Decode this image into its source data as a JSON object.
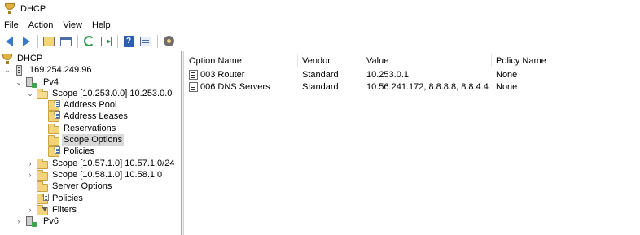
{
  "window": {
    "title": "DHCP"
  },
  "menu": [
    "File",
    "Action",
    "View",
    "Help"
  ],
  "toolbar": {
    "buttons": [
      "back-icon",
      "forward-icon",
      "up-folder-icon",
      "show-hide-tree-icon",
      "refresh-icon",
      "export-list-icon",
      "help-icon",
      "properties-icon",
      "dhcp-manage-icon"
    ]
  },
  "tree": {
    "root": "DHCP",
    "server": "169.254.249.96",
    "ipv4": "IPv4",
    "scope1": "Scope [10.253.0.0] 10.253.0.0",
    "address_pool": "Address Pool",
    "address_leases": "Address Leases",
    "reservations": "Reservations",
    "scope_options": "Scope Options",
    "policies_scope": "Policies",
    "scope2": "Scope [10.57.1.0] 10.57.1.0/24",
    "scope3": "Scope [10.58.1.0] 10.58.1.0",
    "server_options": "Server Options",
    "policies": "Policies",
    "filters": "Filters",
    "ipv6": "IPv6"
  },
  "list": {
    "columns": [
      "Option Name",
      "Vendor",
      "Value",
      "Policy Name"
    ],
    "rows": [
      {
        "option_name": "003 Router",
        "vendor": "Standard",
        "value": "10.253.0.1",
        "policy_name": "None"
      },
      {
        "option_name": "006 DNS Servers",
        "vendor": "Standard",
        "value": "10.56.241.172, 8.8.8.8, 8.8.4.4",
        "policy_name": "None"
      }
    ]
  },
  "colors": {
    "selection": "#d9d9d9",
    "folder": "#f3d47a",
    "accent": "#3a78c9"
  }
}
